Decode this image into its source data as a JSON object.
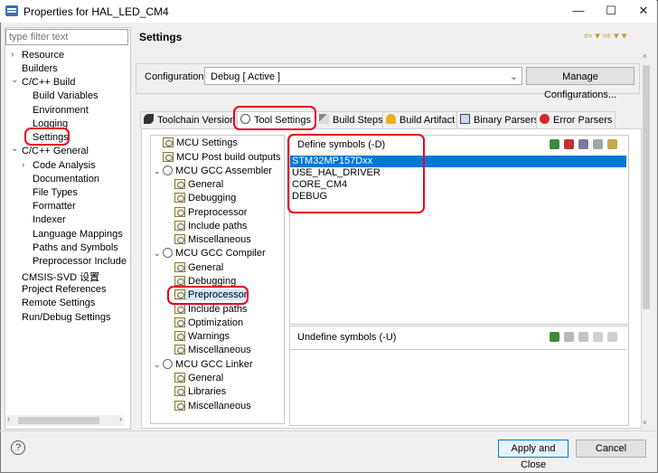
{
  "window": {
    "title": "Properties for HAL_LED_CM4",
    "minimize": "—",
    "maximize": "☐",
    "close": "✕"
  },
  "sidebar": {
    "filter_placeholder": "type filter text",
    "items": [
      {
        "label": "Resource",
        "arrow": "›"
      },
      {
        "label": "Builders"
      },
      {
        "label": "C/C++ Build",
        "arrow": "⌄"
      },
      {
        "label": "Build Variables"
      },
      {
        "label": "Environment"
      },
      {
        "label": "Logging"
      },
      {
        "label": "Settings"
      },
      {
        "label": "C/C++ General",
        "arrow": "⌄"
      },
      {
        "label": "Code Analysis",
        "arrow": "›"
      },
      {
        "label": "Documentation"
      },
      {
        "label": "File Types"
      },
      {
        "label": "Formatter"
      },
      {
        "label": "Indexer"
      },
      {
        "label": "Language Mappings"
      },
      {
        "label": "Paths and Symbols"
      },
      {
        "label": "Preprocessor Include"
      },
      {
        "label": "CMSIS-SVD 设置"
      },
      {
        "label": "Project References"
      },
      {
        "label": "Remote Settings"
      },
      {
        "label": "Run/Debug Settings"
      }
    ]
  },
  "page": {
    "title": "Settings",
    "nav": "⇦ ▾ ⇨ ▾ ▾"
  },
  "configuration": {
    "label": "Configuration:",
    "value": "Debug  [ Active ]",
    "manage": "Manage Configurations..."
  },
  "tabs": [
    {
      "label": "Toolchain Version"
    },
    {
      "label": "Tool Settings"
    },
    {
      "label": "Build Steps"
    },
    {
      "label": "Build Artifact"
    },
    {
      "label": "Binary Parsers"
    },
    {
      "label": "Error Parsers"
    }
  ],
  "tool_tree": [
    {
      "label": "MCU Settings"
    },
    {
      "label": "MCU Post build outputs"
    },
    {
      "label": "MCU GCC Assembler"
    },
    {
      "label": "General"
    },
    {
      "label": "Debugging"
    },
    {
      "label": "Preprocessor"
    },
    {
      "label": "Include paths"
    },
    {
      "label": "Miscellaneous"
    },
    {
      "label": "MCU GCC Compiler"
    },
    {
      "label": "General"
    },
    {
      "label": "Debugging"
    },
    {
      "label": "Preprocessor"
    },
    {
      "label": "Include paths"
    },
    {
      "label": "Optimization"
    },
    {
      "label": "Warnings"
    },
    {
      "label": "Miscellaneous"
    },
    {
      "label": "MCU GCC Linker"
    },
    {
      "label": "General"
    },
    {
      "label": "Libraries"
    },
    {
      "label": "Miscellaneous"
    }
  ],
  "define": {
    "title": "Define symbols (-D)",
    "symbols": [
      "STM32MP157Dxx",
      "USE_HAL_DRIVER",
      "CORE_CM4",
      "DEBUG"
    ]
  },
  "undefine": {
    "title": "Undefine symbols (-U)"
  },
  "buttons": {
    "help": "?",
    "apply": "Apply and Close",
    "cancel": "Cancel"
  },
  "colors": {
    "selection": "#0078d7",
    "highlight_ring": "#e8001c"
  }
}
